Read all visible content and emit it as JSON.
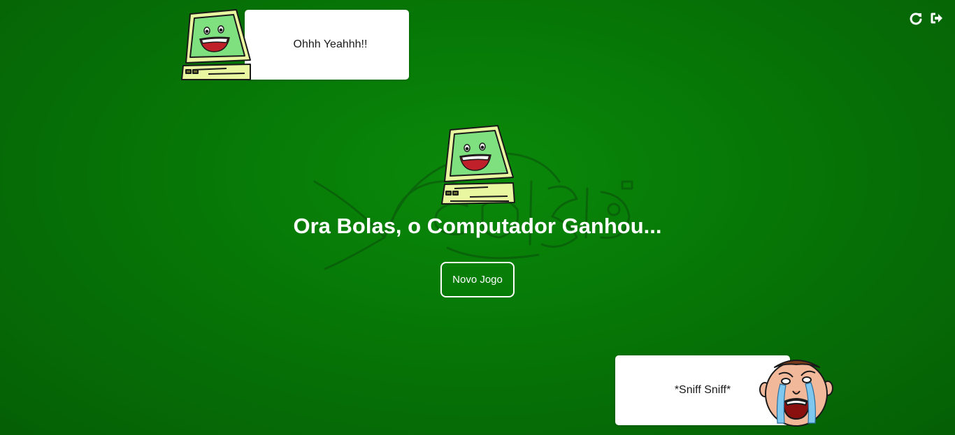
{
  "controls": {
    "restart_icon": "restart-icon",
    "logout_icon": "logout-icon"
  },
  "computer_bubble": {
    "text": "Ohhh Yeahhh!!"
  },
  "player_bubble": {
    "text": "*Sniff Sniff*"
  },
  "result": {
    "title": "Ora Bolas, o Computador Ganhou..."
  },
  "new_game_button": {
    "label": "Novo Jogo"
  },
  "colors": {
    "background": "#067606",
    "text": "#ffffff",
    "bubble": "#ffffff"
  }
}
